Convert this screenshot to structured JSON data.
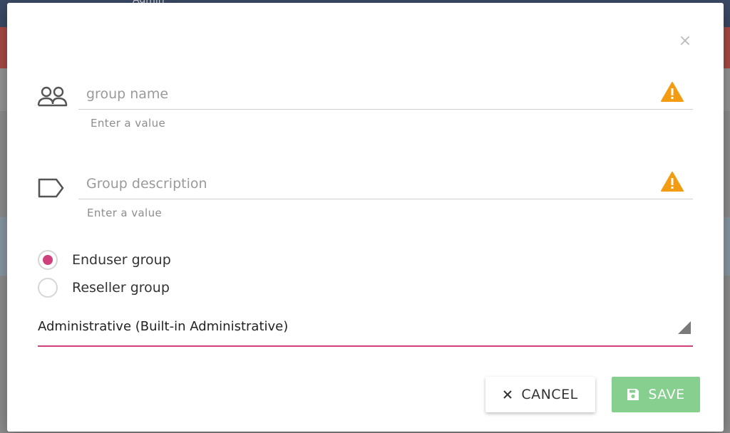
{
  "background": {
    "title": "Admin"
  },
  "dialog": {
    "close_label": "×",
    "fields": {
      "group_name": {
        "placeholder": "group name",
        "helper": "Enter a value"
      },
      "group_description": {
        "placeholder": "Group description",
        "helper": "Enter a value"
      }
    },
    "radios": [
      {
        "label": "Enduser group",
        "selected": true
      },
      {
        "label": "Reseller group",
        "selected": false
      }
    ],
    "select": {
      "value": "Administrative (Built-in Administrative)"
    },
    "buttons": {
      "cancel": "CANCEL",
      "save": "SAVE"
    }
  },
  "colors": {
    "accent": "#d0407d",
    "warning": "#f39c12",
    "save_bg": "#86cf8e"
  },
  "icons": [
    "group-icon",
    "tag-icon",
    "warning-icon",
    "close-icon",
    "dropdown-arrow-icon",
    "save-icon"
  ]
}
